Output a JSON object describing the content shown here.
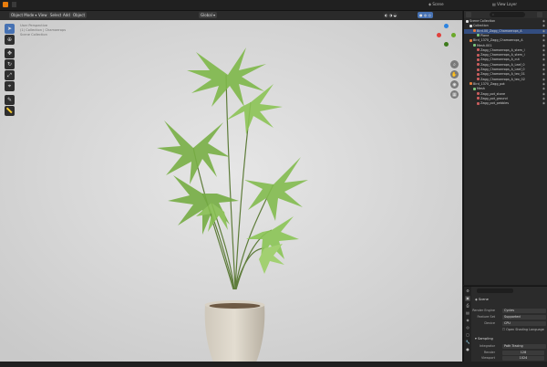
{
  "topbar": {
    "scene_label": "Scene",
    "view_layer_label": "View Layer"
  },
  "viewport_header": {
    "mode": "Object Mode",
    "view": "View",
    "select": "Select",
    "add": "Add",
    "object": "Object",
    "transform": "Global",
    "options": "Options"
  },
  "viewport": {
    "info_lines": [
      "User Perspective",
      "(1) Collection | Chamaerops",
      "Scene Collection"
    ]
  },
  "outliner": {
    "search_placeholder": "",
    "items": [
      {
        "label": "Scene Collection",
        "indent": 0,
        "color": "#dddddd"
      },
      {
        "label": "Collection",
        "indent": 1,
        "color": "#dddddd"
      },
      {
        "label": "Bird.00_Zagg_Chamaerops_A",
        "indent": 2,
        "color": "#e07a3b",
        "selected": true
      },
      {
        "label": "Plane",
        "indent": 3,
        "color": "#7bc47b"
      },
      {
        "label": "Bird_1370_Zagg_Chamaerops_A",
        "indent": 1,
        "color": "#e07a3b"
      },
      {
        "label": "Mesh.001",
        "indent": 2,
        "color": "#7bc47b"
      },
      {
        "label": "Zagg_Chamaerops_A_stem_l",
        "indent": 3,
        "color": "#c85d5d"
      },
      {
        "label": "Zagg_Chamaerops_A_stem_i",
        "indent": 3,
        "color": "#c85d5d"
      },
      {
        "label": "Zagg_Chamaerops_A_cut",
        "indent": 3,
        "color": "#c85d5d"
      },
      {
        "label": "Zagg_Chamaerops_A_Leaf_0",
        "indent": 3,
        "color": "#c85d5d"
      },
      {
        "label": "Zagg_Chamaerops_A_Leaf_0",
        "indent": 3,
        "color": "#c85d5d"
      },
      {
        "label": "Zagg_Chamaerops_A_tex_01",
        "indent": 3,
        "color": "#c85d5d"
      },
      {
        "label": "Zagg_Chamaerops_A_tex_02",
        "indent": 3,
        "color": "#c85d5d"
      },
      {
        "label": "Bird_1370_Zagg_pot",
        "indent": 1,
        "color": "#e07a3b"
      },
      {
        "label": "Mesh",
        "indent": 2,
        "color": "#7bc47b"
      },
      {
        "label": "Zagg_pot_stone",
        "indent": 3,
        "color": "#c85d5d"
      },
      {
        "label": "Zagg_pot_ground",
        "indent": 3,
        "color": "#c85d5d"
      },
      {
        "label": "Zagg_pot_pebbles",
        "indent": 3,
        "color": "#c85d5d"
      }
    ]
  },
  "properties": {
    "scene_label": "Scene",
    "render_engine_label": "Render Engine",
    "render_engine": "Cycles",
    "feature_set_label": "Feature Set",
    "feature_set": "Supported",
    "device_label": "Device",
    "device": "CPU",
    "osl_label": "Open Shading Language",
    "sampling_label": "Sampling",
    "integrator_label": "Integrator",
    "integrator": "Path Tracing",
    "render_label": "Render",
    "render_value": "128",
    "viewport_label": "Viewport",
    "viewport_value": "1024"
  }
}
